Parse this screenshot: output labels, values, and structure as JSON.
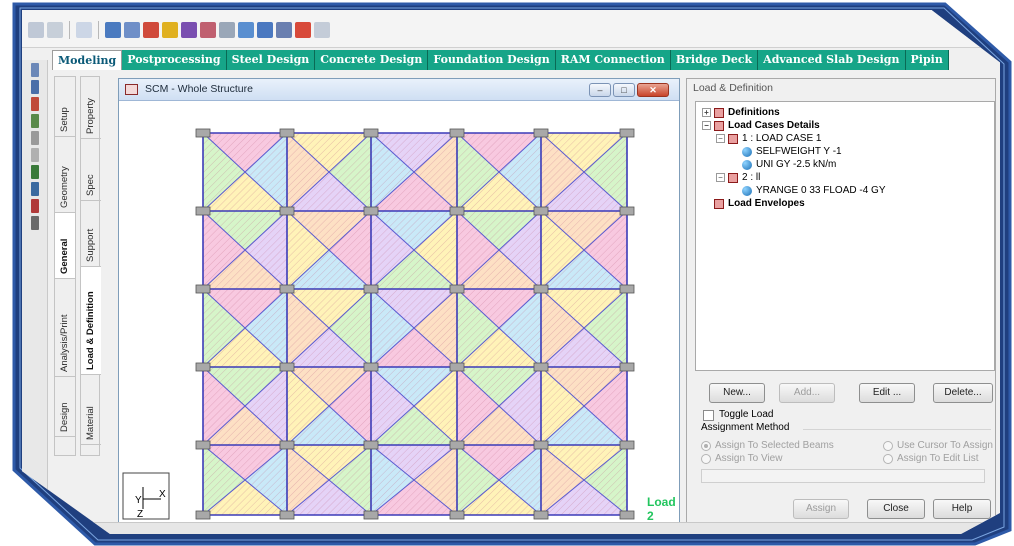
{
  "ribbon": {
    "tabs": [
      {
        "label": "Modeling",
        "active": true
      },
      {
        "label": "Postprocessing"
      },
      {
        "label": "Steel Design"
      },
      {
        "label": "Concrete Design"
      },
      {
        "label": "Foundation Design"
      },
      {
        "label": "RAM Connection"
      },
      {
        "label": "Bridge Deck"
      },
      {
        "label": "Advanced Slab Design"
      },
      {
        "label": "Pipin"
      }
    ]
  },
  "left_tabs_outer": [
    "Setup",
    "Geometry",
    "General",
    "Analysis/Print",
    "Design"
  ],
  "left_tabs_inner": [
    "Property",
    "Spec",
    "Support",
    "Load & Definition",
    "Material"
  ],
  "structure_window": {
    "title": "SCM - Whole Structure",
    "load_label": "Load 2",
    "axis_y": "Y",
    "axis_x": "X",
    "axis_z": "Z"
  },
  "panel": {
    "title": "Load & Definition",
    "tree": {
      "definitions": "Definitions",
      "load_cases_details": "Load Cases Details",
      "case1": "1 : LOAD CASE 1",
      "case1_item1": "SELFWEIGHT Y -1",
      "case1_item2": "UNI GY -2.5 kN/m",
      "case2": "2 : ll",
      "case2_item1": "YRANGE 0 33 FLOAD -4 GY",
      "load_envelopes": "Load Envelopes"
    },
    "buttons": {
      "new": "New...",
      "add": "Add...",
      "edit": "Edit ...",
      "delete": "Delete...",
      "assign": "Assign",
      "close": "Close",
      "help": "Help"
    },
    "toggle_load": "Toggle Load",
    "assignment_method": "Assignment Method",
    "radio": {
      "assign_selected_beams": "Assign To Selected Beams",
      "use_cursor": "Use Cursor To Assign",
      "assign_to_view": "Assign To View",
      "assign_edit_list": "Assign To Edit List"
    }
  }
}
